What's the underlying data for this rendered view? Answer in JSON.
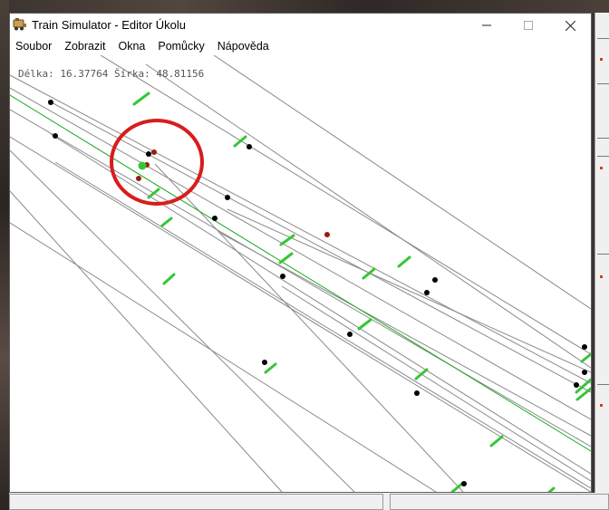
{
  "window": {
    "title": "Train Simulator - Editor Úkolu",
    "minimize_glyph": "—",
    "maximize_glyph": "☐",
    "close_glyph": "✕"
  },
  "menu": {
    "items": [
      "Soubor",
      "Zobrazit",
      "Okna",
      "Pomůcky",
      "Nápověda"
    ]
  },
  "canvas": {
    "coords_label": "Délka: 16.37764 Šírka: 48.81156"
  },
  "colors": {
    "track": "#8a8a8a",
    "selected_track": "#1ea81e",
    "marker": "#35c635",
    "node": "#000000",
    "red_node": "#9a1a10",
    "highlight_circle": "#d81d1d"
  },
  "icons": {
    "app": "train-app-icon"
  }
}
